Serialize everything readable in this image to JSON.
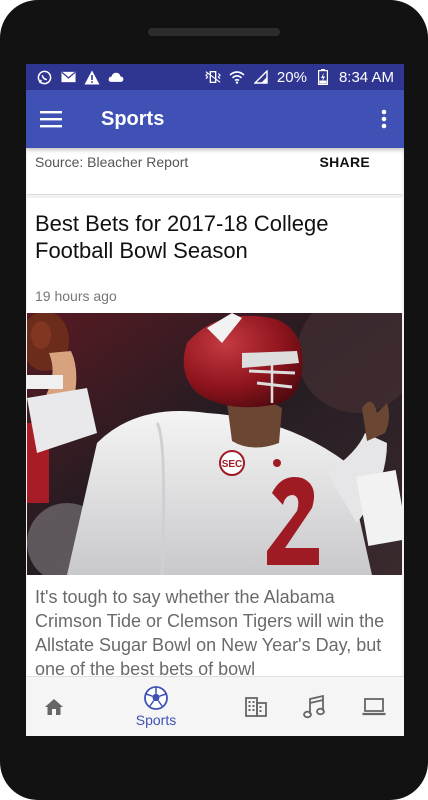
{
  "status_bar": {
    "battery": "20%",
    "time": "8:34 AM",
    "icons": [
      "whatsapp-icon",
      "email-icon",
      "warning-icon",
      "cloud-icon",
      "vibrate-icon",
      "wifi-icon",
      "signal-icon",
      "battery-icon"
    ]
  },
  "app_bar": {
    "title": "Sports",
    "icons": [
      "menu-icon",
      "more-vert-icon"
    ]
  },
  "previous_card": {
    "source": "Source:  Bleacher Report",
    "share_label": "SHARE"
  },
  "article": {
    "headline": "Best Bets for 2017-18 College Football Bowl Season",
    "timestamp": "19 hours ago",
    "image_subject": "football-quarterback-photo",
    "summary": "It's tough to say whether the Alabama Crimson Tide or Clemson Tigers will win the Allstate Sugar Bowl on New Year's Day, but  one of the best bets of bowl"
  },
  "bottom_nav": {
    "items": [
      {
        "icon": "home-icon",
        "label": ""
      },
      {
        "icon": "soccer-ball-icon",
        "label": "Sports",
        "active": true
      },
      {
        "icon": "building-icon",
        "label": ""
      },
      {
        "icon": "music-icon",
        "label": ""
      },
      {
        "icon": "laptop-icon",
        "label": ""
      }
    ]
  },
  "colors": {
    "status_bar": "#2e3692",
    "app_bar": "#3f51b5",
    "accent": "#3f51b5"
  }
}
